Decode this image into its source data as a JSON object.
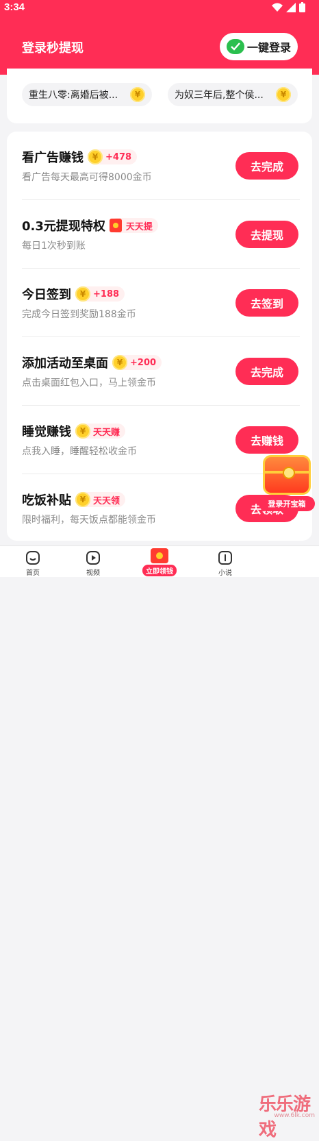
{
  "status_bar": {
    "time": "3:34"
  },
  "header": {
    "title": "登录秒提现",
    "login_label": "一键登录"
  },
  "books": [
    {
      "title": "重生八零:离婚后被..."
    },
    {
      "title": "为奴三年后,整个侯..."
    }
  ],
  "coin_symbol": "¥",
  "tasks": [
    {
      "name": "看广告赚钱",
      "badge": "+478",
      "badge_type": "coin",
      "desc": "看广告每天最高可得8000金币",
      "action": "去完成"
    },
    {
      "name": "0.3元提现特权",
      "badge": "天天提",
      "badge_type": "hongbao",
      "desc": "每日1次秒到账",
      "action": "去提现"
    },
    {
      "name": "今日签到",
      "badge": "+188",
      "badge_type": "coin",
      "desc": "完成今日签到奖励188金币",
      "action": "去签到"
    },
    {
      "name": "添加活动至桌面",
      "badge": "+200",
      "badge_type": "coin",
      "desc": "点击桌面红包入口，马上领金币",
      "action": "去完成"
    },
    {
      "name": "睡觉赚钱",
      "badge": "天天赚",
      "badge_type": "coin",
      "desc": "点我入睡，睡醒轻松收金币",
      "action": "去赚钱"
    },
    {
      "name": "吃饭补贴",
      "badge": "天天领",
      "badge_type": "coin",
      "desc": "限时福利，每天饭点都能领金币",
      "action": "去领取"
    }
  ],
  "treasure": {
    "label": "登录开宝箱"
  },
  "nav": {
    "home": "首页",
    "video": "视频",
    "center": "立即领钱",
    "novel": "小说"
  },
  "watermark": {
    "big": "乐乐游戏",
    "small": "www.6lk.com"
  },
  "colors": {
    "brand": "#ff2d55",
    "coin": "#ffd02b",
    "wechat": "#2bbf4e"
  }
}
